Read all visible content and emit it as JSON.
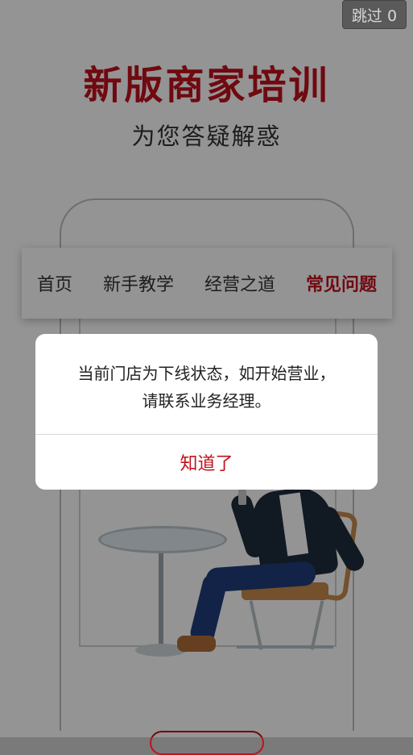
{
  "skip": {
    "label": "跳过 0"
  },
  "hero": {
    "title": "新版商家培训",
    "subtitle": "为您答疑解惑"
  },
  "nav": {
    "items": [
      {
        "label": "首页"
      },
      {
        "label": "新手教学"
      },
      {
        "label": "经营之道"
      },
      {
        "label": "常见问题"
      }
    ],
    "active_index": 3
  },
  "dialog": {
    "message_line1": "当前门店为下线状态，如开始营业，",
    "message_line2": "请联系业务经理。",
    "button_label": "知道了"
  },
  "colors": {
    "accent": "#c2111c",
    "overlay": "rgba(0,0,0,0.42)"
  }
}
